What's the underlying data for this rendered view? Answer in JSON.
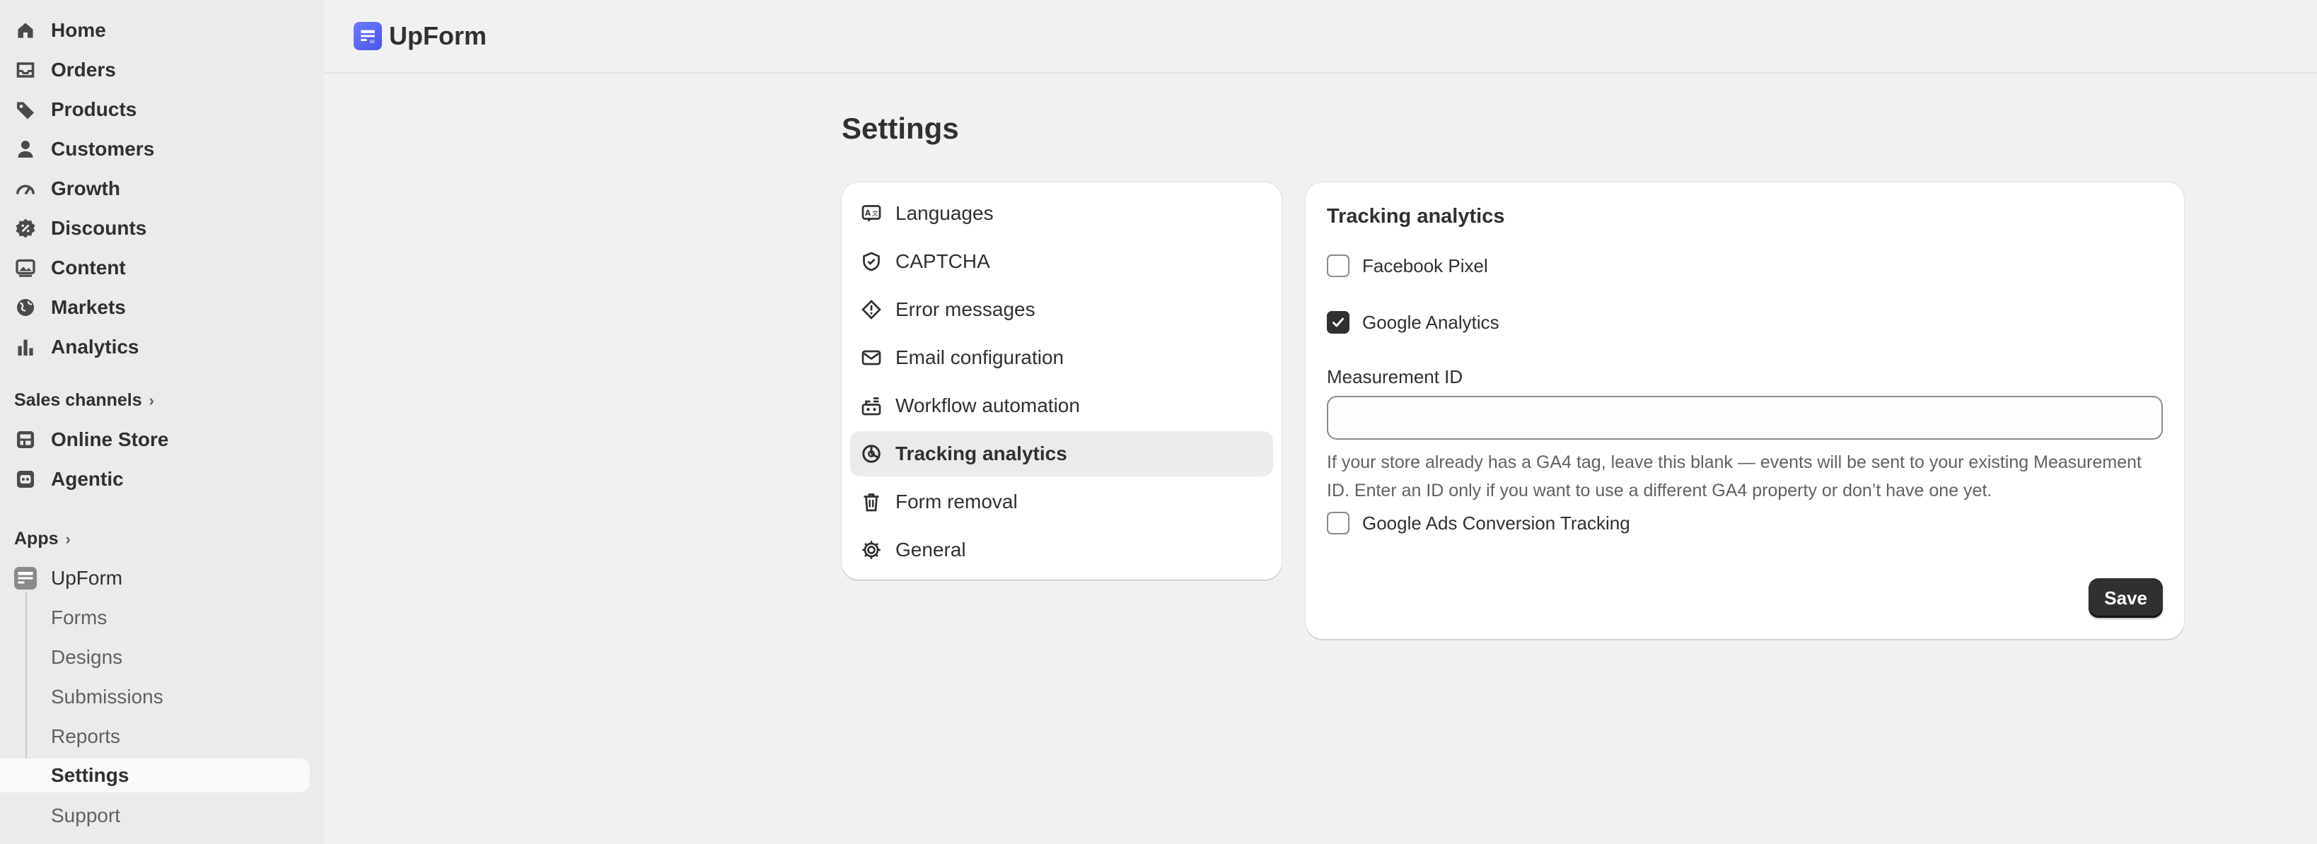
{
  "sidebar": {
    "nav": [
      {
        "label": "Home",
        "icon": "home-icon"
      },
      {
        "label": "Orders",
        "icon": "inbox-icon"
      },
      {
        "label": "Products",
        "icon": "tag-icon"
      },
      {
        "label": "Customers",
        "icon": "person-icon"
      },
      {
        "label": "Growth",
        "icon": "gauge-icon"
      },
      {
        "label": "Discounts",
        "icon": "discount-icon"
      },
      {
        "label": "Content",
        "icon": "image-icon"
      },
      {
        "label": "Markets",
        "icon": "globe-icon"
      },
      {
        "label": "Analytics",
        "icon": "bar-chart-icon"
      }
    ],
    "sales_channels_label": "Sales channels",
    "channels": [
      {
        "label": "Online Store",
        "icon": "store-icon"
      },
      {
        "label": "Agentic",
        "icon": "robot-icon"
      }
    ],
    "apps_label": "Apps",
    "app": {
      "label": "UpForm",
      "icon": "upform-app-icon"
    },
    "app_subitems": [
      "Forms",
      "Designs",
      "Submissions",
      "Reports",
      "Settings",
      "Support"
    ],
    "active_subitem": "Settings"
  },
  "header": {
    "brand": "UpForm"
  },
  "page": {
    "title": "Settings"
  },
  "settings_menu": [
    {
      "label": "Languages",
      "icon": "languages-icon"
    },
    {
      "label": "CAPTCHA",
      "icon": "shield-check-icon"
    },
    {
      "label": "Error messages",
      "icon": "alert-diamond-icon"
    },
    {
      "label": "Email configuration",
      "icon": "envelope-icon"
    },
    {
      "label": "Workflow automation",
      "icon": "automation-icon"
    },
    {
      "label": "Tracking analytics",
      "icon": "chart-pie-icon"
    },
    {
      "label": "Form removal",
      "icon": "trash-icon"
    },
    {
      "label": "General",
      "icon": "gear-icon"
    }
  ],
  "active_menu": "Tracking analytics",
  "panel": {
    "title": "Tracking analytics",
    "facebook_pixel": {
      "label": "Facebook Pixel",
      "checked": false
    },
    "google_analytics": {
      "label": "Google Analytics",
      "checked": true
    },
    "measurement_id": {
      "label": "Measurement ID",
      "value": "",
      "placeholder": ""
    },
    "help": "If your store already has a GA4 tag, leave this blank — events will be sent to your existing Measurement ID. Enter an ID only if you want to use a different GA4 property or don’t have one yet.",
    "google_ads": {
      "label": "Google Ads Conversion Tracking",
      "checked": false
    },
    "save_label": "Save"
  },
  "colors": {
    "sidebar_bg": "#ebebeb",
    "page_bg": "#f1f1f1",
    "primary_button": "#303030",
    "brand_accent": "#5b67f1"
  }
}
